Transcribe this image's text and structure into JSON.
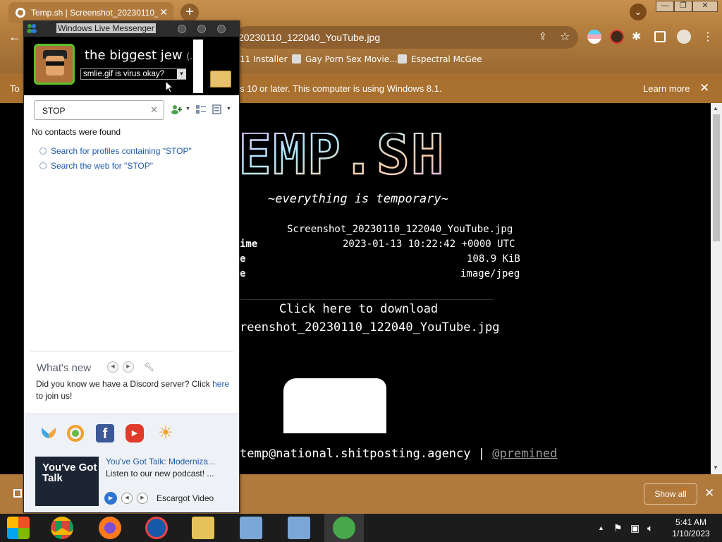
{
  "browser": {
    "tab_title": "Temp.sh | Screenshot_20230110_",
    "tab_close": "✕",
    "new_tab": "+",
    "url_visible": "20230110_122040_YouTube.jpg",
    "window_controls": [
      "—",
      "❐",
      "✕"
    ],
    "bookmarks": [
      "11 Installer",
      "Gay Porn Sex Movie...",
      "Espectral McGee"
    ],
    "infobar": {
      "message": "To",
      "message_tail": "s 10 or later. This computer is using Windows 8.1.",
      "learn_more": "Learn more",
      "close": "✕"
    }
  },
  "page": {
    "logo_text": "EMP.SH",
    "tagline": "~everything is temporary~",
    "file_name": "Screenshot_20230110_122040_YouTube.jpg",
    "labels": [
      "ime",
      "e",
      "e"
    ],
    "expiry": "2023-01-13 10:22:42 +0000 UTC",
    "size": "108.9 KiB",
    "mime": "image/jpeg",
    "download_label": "Click here to download",
    "download_file": "reenshot_20230110_122040_YouTube.jpg",
    "footer_email": "temp@national.shitposting.agency",
    "footer_sep": "|",
    "footer_handle": "@premined"
  },
  "download_bar": {
    "show_all": "Show all",
    "close": "✕"
  },
  "taskbar": {
    "time": "5:41 AM",
    "date": "1/10/2023"
  },
  "messenger": {
    "window_title": "Windows Live Messenger",
    "display_name": "the biggest jew",
    "display_name_more": "(...",
    "personal_message": "smlie.gif is virus okay?",
    "search_value": "STOP",
    "no_contacts": "No contacts were found",
    "search_profiles": "Search for profiles containing \"STOP\"",
    "search_web": "Search the web for \"STOP\"",
    "whats_new_title": "What's new",
    "whats_new_text": "Did you know we have a Discord server? Click",
    "whats_new_link": "here",
    "whats_new_tail": "to join us!",
    "ad_title": "You've Got Talk: Moderniza...",
    "ad_subtitle": "Listen to our new podcast! ...",
    "ad_thumb_text": "You've Got Talk",
    "ad_source": "Escargot Video"
  },
  "colors": {
    "chrome_accent": "#b17a3d",
    "link_blue": "#1e5aa8",
    "avatar_border": "#57c228"
  }
}
